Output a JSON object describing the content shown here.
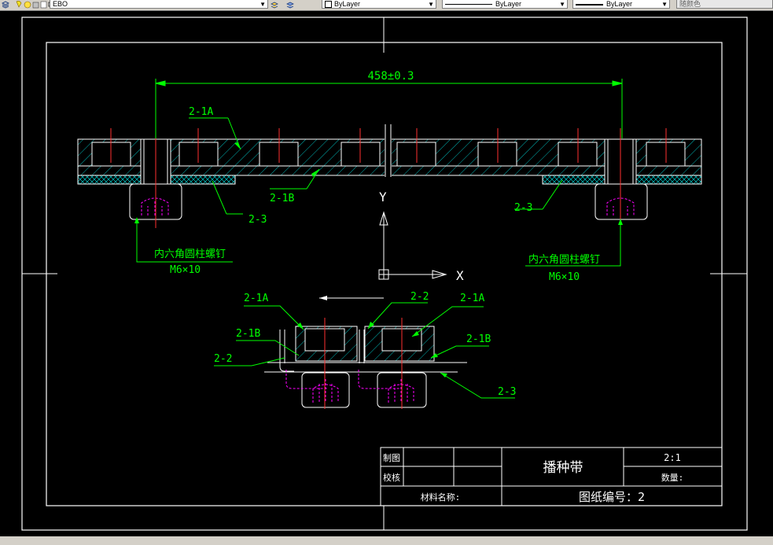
{
  "toolbar": {
    "layer_name": "EBO",
    "color_value": "ByLayer",
    "linetype_value": "ByLayer",
    "lineweight_value": "ByLayer",
    "plotstyle_value": "随颜色"
  },
  "drawing": {
    "dimension": "458±0.3",
    "axis_y": "Y",
    "axis_x": "X",
    "top_labels": {
      "label_2_1A": "2-1A",
      "label_2_1B": "2-1B",
      "label_2_3_left": "2-3",
      "label_2_3_right": "2-3",
      "screw_name_left": "内六角圆柱螺钉",
      "screw_size_left": "M6×10",
      "screw_name_right": "内六角圆柱螺钉",
      "screw_size_right": "M6×10"
    },
    "bottom_labels": {
      "left_2_1A": "2-1A",
      "left_2_1B": "2-1B",
      "left_2_2": "2-2",
      "center_2_2": "2-2",
      "right_2_1A": "2-1A",
      "right_2_1B": "2-1B",
      "right_2_3": "2-3"
    }
  },
  "title_block": {
    "drawn_label": "制图",
    "checked_label": "校核",
    "part_name": "播种带",
    "scale": "2:1",
    "quantity_label": "数量:",
    "material_label": "材料名称:",
    "drawing_number": "图纸编号：2"
  },
  "colors": {
    "background": "#000000",
    "outline": "#ffffff",
    "hatch": "#00c8c8",
    "annotation": "#00ff00",
    "centerline": "#ff3030",
    "hidden": "#ff00ff",
    "toolbar": "#d4d0c8"
  }
}
